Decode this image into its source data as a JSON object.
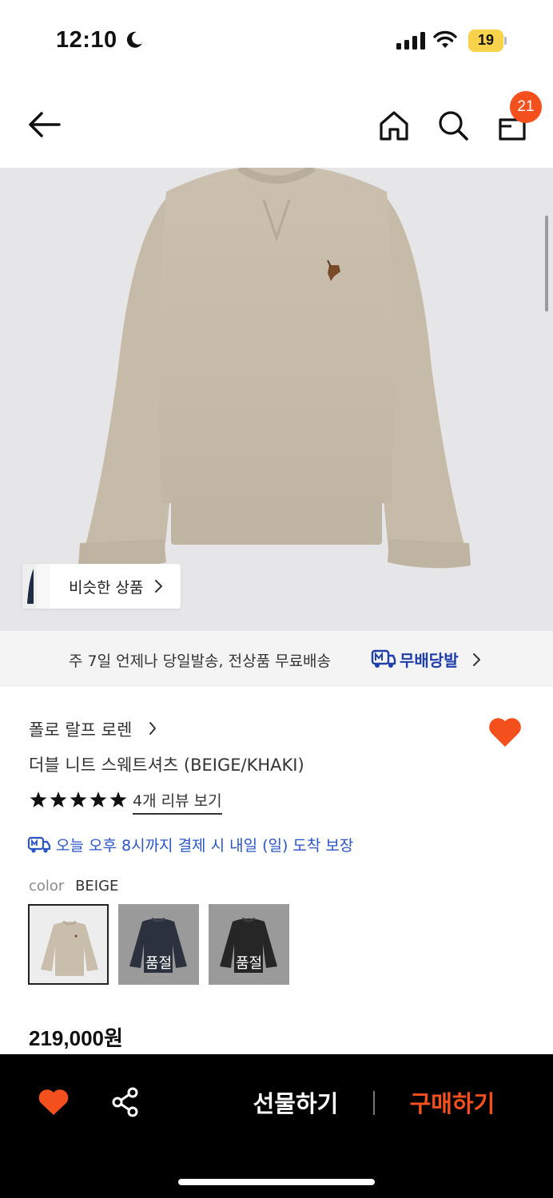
{
  "status_bar": {
    "time": "12:10",
    "battery": "19"
  },
  "header": {
    "cart_count": "21"
  },
  "gallery": {
    "similar_label": "비슷한 상품"
  },
  "shipping_banner": {
    "text": "주 7일 언제나 당일발송, 전상품 무료배송",
    "badge": "무배당발"
  },
  "product": {
    "brand": "폴로 랄프 로렌",
    "title": "더블 니트 스웨트셔츠 (BEIGE/KHAKI)",
    "rating_stars": 5,
    "review_link": "4개 리뷰 보기",
    "delivery_notice": "오늘 오후 8시까지 결제 시 내일 (일) 도착 보장",
    "color_label": "color",
    "color_value": "BEIGE",
    "swatches": [
      {
        "color": "beige",
        "sold_out": ""
      },
      {
        "color": "navy",
        "sold_out": "품절"
      },
      {
        "color": "black",
        "sold_out": "품절"
      }
    ],
    "price": "219,000원"
  },
  "bottom_bar": {
    "gift_label": "선물하기",
    "buy_label": "구매하기"
  },
  "colors": {
    "accent_orange": "#f4501e",
    "link_blue": "#2a55c8",
    "badge_blue": "#1e3ea8",
    "sweater_beige": "#c8bcaa"
  }
}
